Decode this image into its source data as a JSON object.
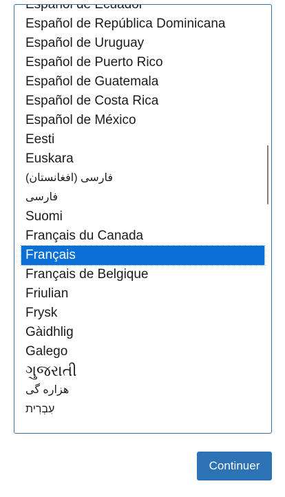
{
  "language_list": {
    "options": [
      "Español de Ecuador",
      "Español de República Dominicana",
      "Español de Uruguay",
      "Español de Puerto Rico",
      "Español de Guatemala",
      "Español de Costa Rica",
      "Español de México",
      "Eesti",
      "Euskara",
      "فارسی (افغانستان)",
      "فارسی",
      "Suomi",
      "Français du Canada",
      "Français",
      "Français de Belgique",
      "Friulian",
      "Frysk",
      "Gàidhlig",
      "Galego",
      "ગુજરાતી",
      "هزاره گی",
      "עִבְרִית"
    ],
    "selected": "Français"
  },
  "continue_button": {
    "label": "Continuer"
  },
  "colors": {
    "selection": "#0a6fd6",
    "button": "#2b73b5",
    "border": "#2f6fb5"
  }
}
